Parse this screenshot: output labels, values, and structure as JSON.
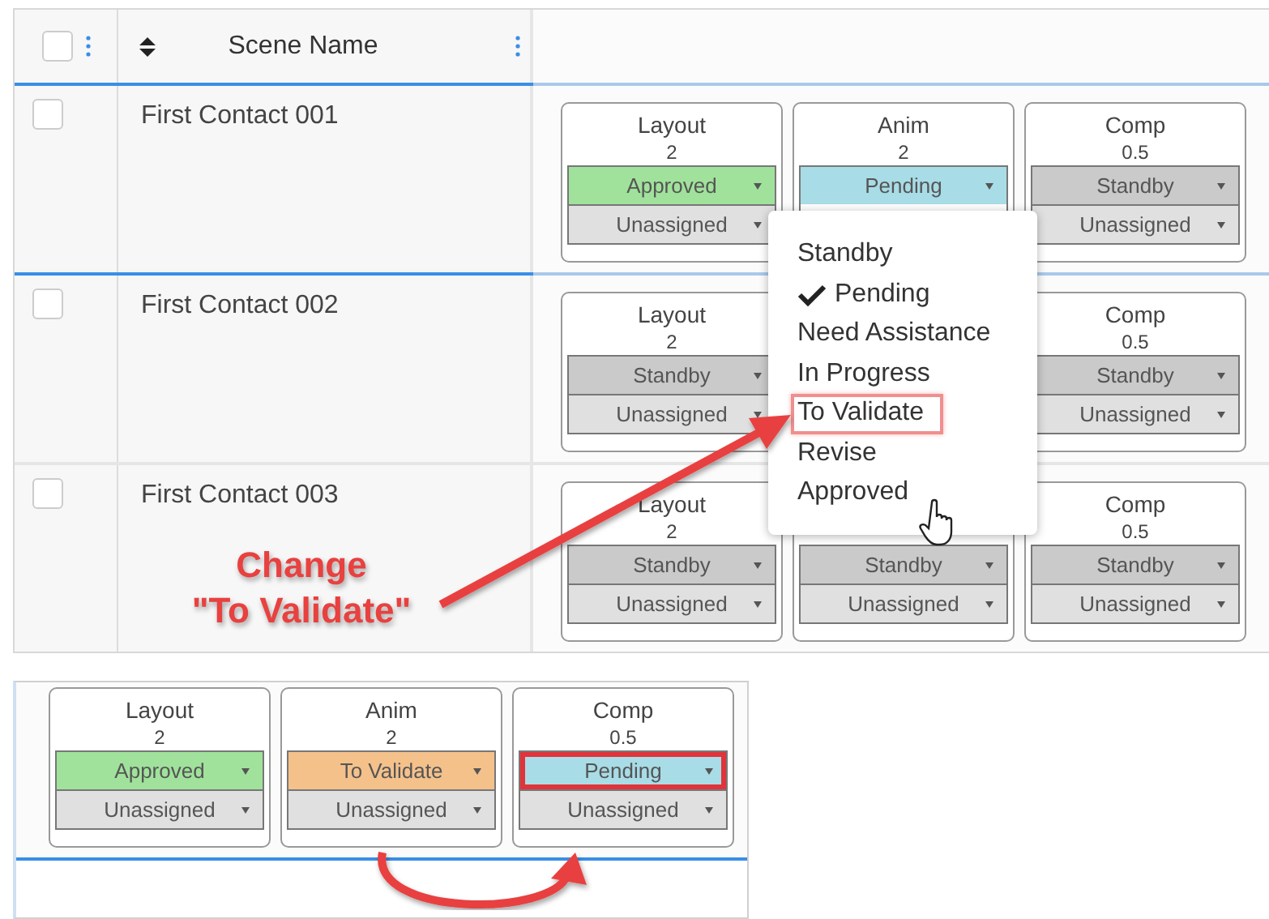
{
  "table": {
    "header": {
      "checked": false,
      "column_title": "Scene Name"
    },
    "rows": [
      {
        "checked": false,
        "name": "First Contact 001",
        "tasks": [
          {
            "title": "Layout",
            "version": "2",
            "status": "Approved",
            "color": "#a0e29b",
            "assignee": "Unassigned"
          },
          {
            "title": "Anim",
            "version": "2",
            "status": "Pending",
            "color": "#a8dce6"
          },
          {
            "title": "Comp",
            "version": "0.5",
            "status": "Standby",
            "color": "#cacaca",
            "assignee": "Unassigned"
          }
        ]
      },
      {
        "checked": false,
        "name": "First Contact 002",
        "tasks": [
          {
            "title": "Layout",
            "version": "2",
            "status": "Standby",
            "color": "#cacaca",
            "assignee": "Unassigned"
          },
          {
            "title": "Comp",
            "version": "0.5",
            "status": "Standby",
            "color": "#cacaca",
            "assignee": "Unassigned"
          }
        ]
      },
      {
        "checked": false,
        "name": "First Contact 003",
        "tasks": [
          {
            "title": "Layout",
            "version": "2",
            "status": "Standby",
            "color": "#cacaca",
            "assignee": "Unassigned"
          },
          {
            "status": "Standby",
            "color": "#cacaca",
            "assignee": "Unassigned"
          },
          {
            "title": "Comp",
            "version": "0.5",
            "status": "Standby",
            "color": "#cacaca",
            "assignee": "Unassigned"
          }
        ]
      }
    ]
  },
  "status_menu": {
    "items": [
      {
        "label": "Standby",
        "checked": false,
        "highlighted": false
      },
      {
        "label": "Pending",
        "checked": true,
        "highlighted": false
      },
      {
        "label": "Need Assistance",
        "checked": false,
        "highlighted": false
      },
      {
        "label": "In Progress",
        "checked": false,
        "highlighted": false
      },
      {
        "label": "To Validate",
        "checked": false,
        "highlighted": true
      },
      {
        "label": "Revise",
        "checked": false,
        "highlighted": false
      },
      {
        "label": "Approved",
        "checked": false,
        "highlighted": false
      }
    ]
  },
  "annotation": {
    "lines": [
      "Change",
      "\"To Validate\""
    ]
  },
  "result_panel": {
    "tasks": [
      {
        "title": "Layout",
        "version": "2",
        "status": "Approved",
        "color": "#a0e29b",
        "assignee": "Unassigned",
        "highlighted": false
      },
      {
        "title": "Anim",
        "version": "2",
        "status": "To Validate",
        "color": "#f5c18b",
        "assignee": "Unassigned",
        "highlighted": false
      },
      {
        "title": "Comp",
        "version": "0.5",
        "status": "Pending",
        "color": "#a8dce6",
        "assignee": "Unassigned",
        "highlighted": true
      }
    ]
  }
}
